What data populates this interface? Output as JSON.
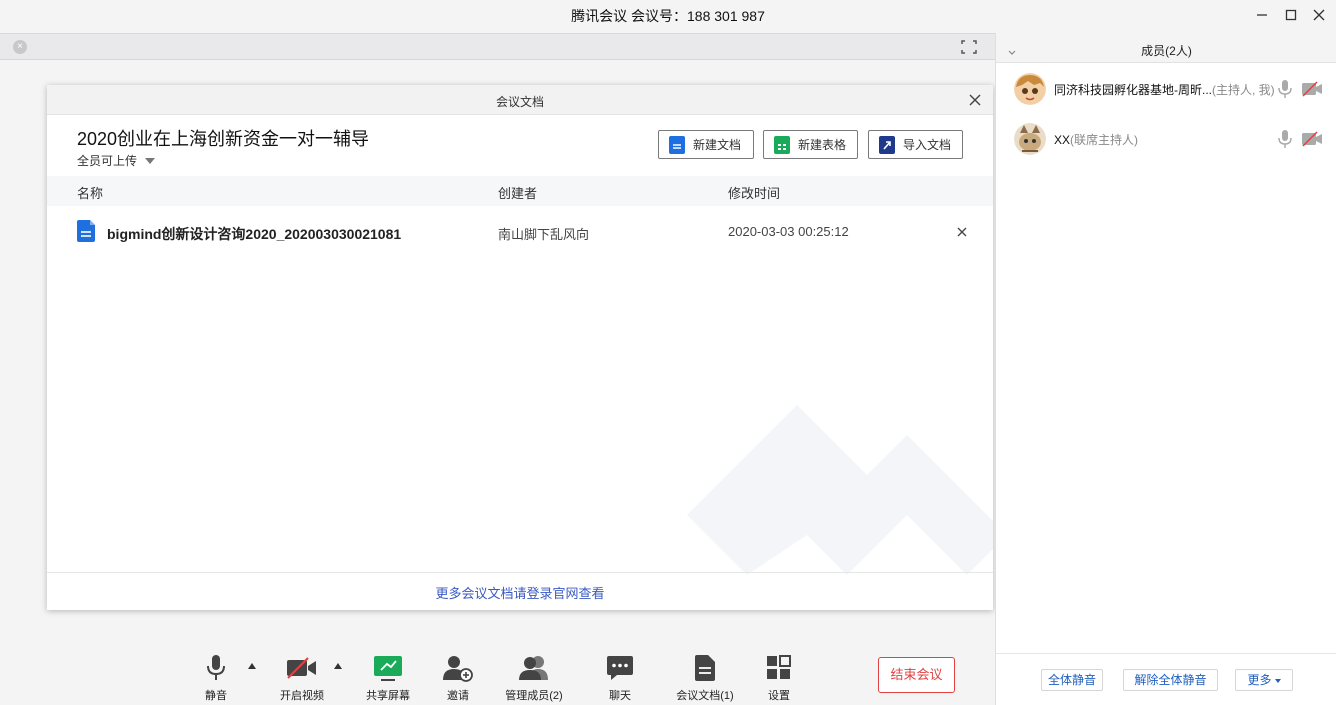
{
  "window": {
    "title": "腾讯会议 会议号：188 301 987",
    "minimize_icon": "minimize-icon",
    "maximize_icon": "maximize-icon",
    "close_icon": "close-icon"
  },
  "doc_dialog": {
    "title": "会议文档",
    "doc_name": "2020创业在上海创新资金一对一辅导",
    "permission": "全员可上传",
    "buttons": {
      "new_doc": "新建文档",
      "new_sheet": "新建表格",
      "import_doc": "导入文档"
    },
    "columns": {
      "name": "名称",
      "creator": "创建者",
      "modified": "修改时间"
    },
    "files": [
      {
        "name": "bigmind创新设计咨询2020_202003030021081",
        "creator": "南山脚下乱风向",
        "modified": "2020-03-03 00:25:12"
      }
    ],
    "footer_link": "更多会议文档请登录官网查看"
  },
  "toolbar": {
    "mute": "静音",
    "video": "开启视频",
    "share": "共享屏幕",
    "invite": "邀请",
    "manage": "管理成员(2)",
    "chat": "聊天",
    "docs": "会议文档(1)",
    "settings": "设置",
    "end": "结束会议"
  },
  "members_panel": {
    "title": "成员(2人)",
    "members": [
      {
        "name": "同济科技园孵化器基地-周昕...",
        "role": "(主持人, 我)"
      },
      {
        "name": "XX",
        "role": "(联席主持人)"
      }
    ],
    "buttons": {
      "mute_all": "全体静音",
      "unmute_all": "解除全体静音",
      "more": "更多"
    }
  },
  "colors": {
    "doc_blue": "#1e6fe0",
    "sheet_green": "#1aab5a",
    "import_navy": "#1f3a8c",
    "end_red": "#e14141",
    "link_blue": "#3a59c2"
  }
}
